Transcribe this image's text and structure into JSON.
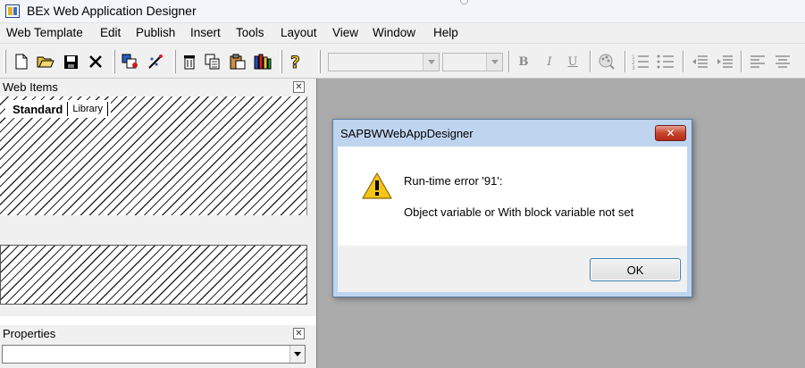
{
  "window": {
    "title": "BEx Web Application Designer"
  },
  "menu": [
    "Web Template",
    "Edit",
    "Publish",
    "Insert",
    "Tools",
    "Layout",
    "View",
    "Window",
    "Help"
  ],
  "toolbar": {
    "icons": [
      "new-icon",
      "open-icon",
      "save-icon",
      "close-icon",
      "web-item-icon",
      "wizard-icon",
      "delete-icon",
      "copy-icon",
      "paste-icon",
      "library-icon",
      "help-icon"
    ],
    "format": {
      "bold": "B",
      "italic": "I",
      "underline": "U"
    }
  },
  "web_items_panel": {
    "title": "Web Items",
    "tabs": [
      "Standard",
      "Library"
    ]
  },
  "properties_panel": {
    "title": "Properties"
  },
  "dialog": {
    "title": "SAPBWWebAppDesigner",
    "line1": "Run-time error '91':",
    "line2": "Object variable or With block variable not set",
    "ok_label": "OK"
  },
  "colors": {
    "dialog_frame": "#bfd4ef",
    "workspace": "#ababab",
    "close_button": "#c9452e"
  }
}
